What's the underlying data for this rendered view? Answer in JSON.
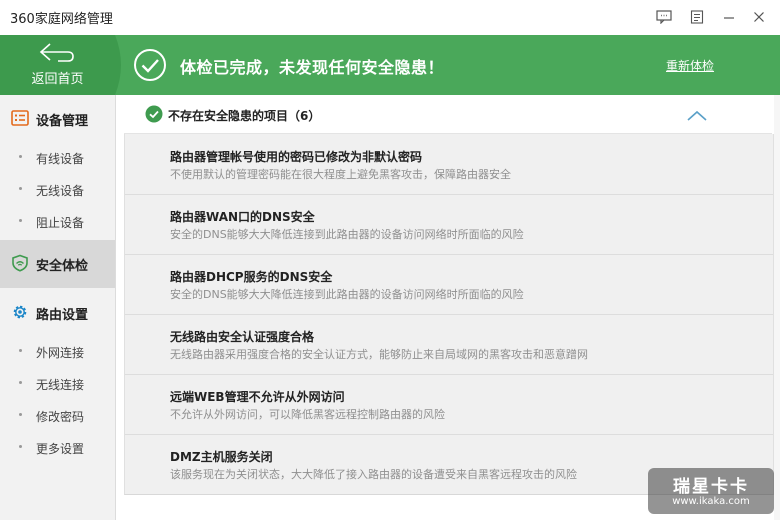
{
  "window": {
    "title": "360家庭网络管理"
  },
  "banner": {
    "back_label": "返回首页",
    "message": "体检已完成，未发现任何安全隐患！",
    "recheck_label": "重新体检",
    "color": "#4aa85a"
  },
  "sidebar": {
    "device_mgmt": {
      "label": "设备管理",
      "icon": "device-list-icon"
    },
    "device_items": [
      {
        "label": "有线设备"
      },
      {
        "label": "无线设备"
      },
      {
        "label": "阻止设备"
      }
    ],
    "security_check": {
      "label": "安全体检",
      "icon": "shield-icon",
      "active": true
    },
    "router_settings": {
      "label": "路由设置",
      "icon": "gear-icon"
    },
    "router_items": [
      {
        "label": "外网连接"
      },
      {
        "label": "无线连接"
      },
      {
        "label": "修改密码"
      },
      {
        "label": "更多设置"
      }
    ]
  },
  "section": {
    "title": "不存在安全隐患的项目（6）",
    "collapse_icon": "chevron-up-icon"
  },
  "items": [
    {
      "title": "路由器管理帐号使用的密码已修改为非默认密码",
      "desc": "不使用默认的管理密码能在很大程度上避免黑客攻击，保障路由器安全"
    },
    {
      "title": "路由器WAN口的DNS安全",
      "desc": "安全的DNS能够大大降低连接到此路由器的设备访问网络时所面临的风险"
    },
    {
      "title": "路由器DHCP服务的DNS安全",
      "desc": "安全的DNS能够大大降低连接到此路由器的设备访问网络时所面临的风险"
    },
    {
      "title": "无线路由安全认证强度合格",
      "desc": "无线路由器采用强度合格的安全认证方式，能够防止来自局域网的黑客攻击和恶意蹭网"
    },
    {
      "title": "远端WEB管理不允许从外网访问",
      "desc": "不允许从外网访问，可以降低黑客远程控制路由器的风险"
    },
    {
      "title": "DMZ主机服务关闭",
      "desc": "该服务现在为关闭状态，大大降低了接入路由器的设备遭受来自黑客远程攻击的风险"
    }
  ],
  "watermark": {
    "name": "瑞星卡卡",
    "url": "www.ikaka.com"
  }
}
